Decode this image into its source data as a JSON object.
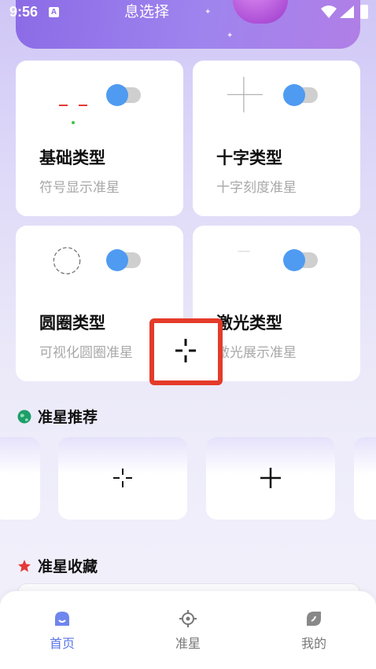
{
  "status_bar": {
    "time": "9:56",
    "notif_letter": "A"
  },
  "banner": {
    "title": "息选择"
  },
  "cards": [
    {
      "title": "基础类型",
      "subtitle": "符号显示准星",
      "toggle_on": true
    },
    {
      "title": "十字类型",
      "subtitle": "十字刻度准星",
      "toggle_on": true
    },
    {
      "title": "圆圈类型",
      "subtitle": "可视化圆圈准星",
      "toggle_on": true
    },
    {
      "title": "激光类型",
      "subtitle": "激光展示准星",
      "toggle_on": true
    }
  ],
  "sections": {
    "recommend": "准星推荐",
    "favorites": "准星收藏"
  },
  "tabs": [
    {
      "label": "首页",
      "icon": "home-icon",
      "active": true
    },
    {
      "label": "准星",
      "icon": "crosshair-icon",
      "active": false
    },
    {
      "label": "我的",
      "icon": "profile-icon",
      "active": false
    }
  ],
  "colors": {
    "accent": "#4f9bf2",
    "active_tab": "#5b76e6",
    "highlight": "#e43b2a",
    "basic_red": "#e53935",
    "basic_green": "#43c343"
  }
}
